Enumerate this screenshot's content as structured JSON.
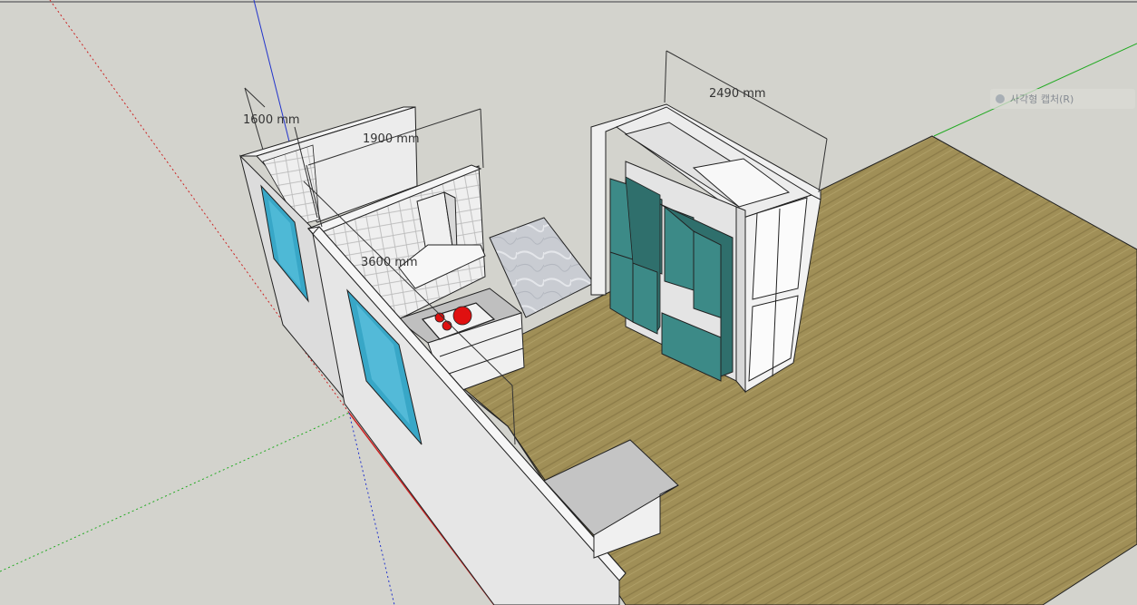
{
  "dimensions": {
    "wall_left_depth": "1600 mm",
    "kitchen_wall_length": "1900 mm",
    "side_wall_length": "3600 mm",
    "cabinet_width": "2490 mm"
  },
  "overlay_tip": {
    "label": "사각형 캡처(R)"
  },
  "colors": {
    "background": "#d3d3cd",
    "floor": "#9a8a55",
    "wall": "#ececec",
    "glass": "#38a7c7",
    "cabinet_door": "#3c8a87",
    "cooktop_burner": "#e01010",
    "axis_red": "#cc2222",
    "axis_green": "#22aa22",
    "axis_blue": "#2233cc"
  },
  "icons": {
    "tip_icon": "capture-icon"
  }
}
